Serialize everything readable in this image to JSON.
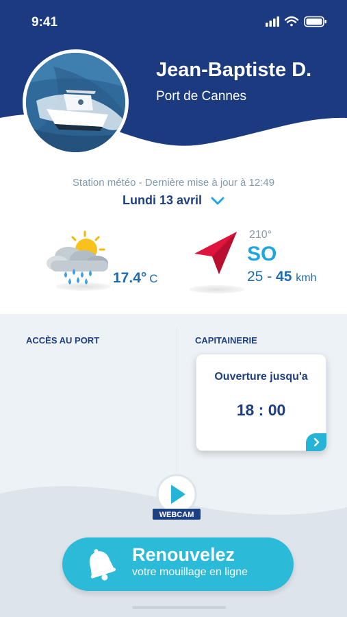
{
  "status_bar": {
    "time": "9:41"
  },
  "profile": {
    "name": "Jean-Baptiste D.",
    "port": "Port de Cannes"
  },
  "weather": {
    "station_text": "Station météo - Dernière mise à jour à 12:49",
    "date": "Lundi 13 avril",
    "temperature": "17.4°",
    "temperature_unit": "C",
    "wind_degree": "210°",
    "wind_direction": "SO",
    "wind_min": "25 -",
    "wind_max": "45",
    "wind_unit": "kmh",
    "weather_icon": "sun-cloud-rain-icon",
    "wind_icon": "wind-direction-arrow-icon"
  },
  "sections": {
    "port_access_label": "ACCÈS AU PORT",
    "harbour_office_label": "CAPITAINERIE",
    "harbour_card_title": "Ouverture jusqu'a",
    "harbour_card_time": "18 : 00"
  },
  "webcam": {
    "label": "WEBCAM"
  },
  "renew": {
    "title": "Renouvelez",
    "subtitle": "votre mouillage en ligne",
    "icon": "bell-icon"
  },
  "colors": {
    "navy": "#1d3f84",
    "accent": "#2bbad8",
    "wind_arrow": "#e0143c",
    "panel_bg": "#edf2f6"
  }
}
